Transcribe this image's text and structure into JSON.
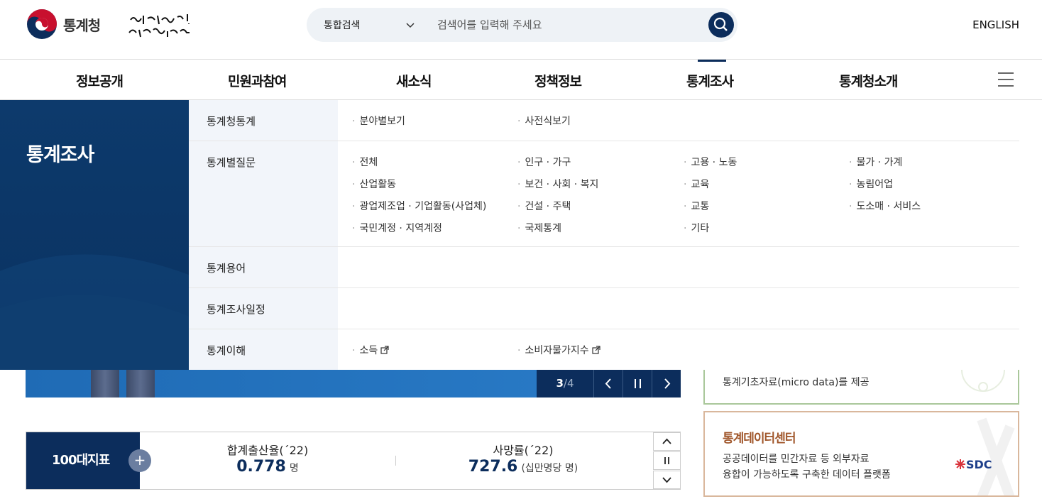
{
  "header": {
    "logo_text": "통계청",
    "search_scope": "통합검색",
    "search_placeholder": "검색어를 입력해 주세요",
    "english_label": "ENGLISH"
  },
  "gnb": {
    "items": [
      "정보공개",
      "민원과참여",
      "새소식",
      "정책정보",
      "통계조사",
      "통계청소개"
    ],
    "active": "통계조사"
  },
  "mega_menu": {
    "title": "통계조사",
    "rows": [
      {
        "label": "통계청통계",
        "items": [
          "분야별보기",
          "사전식보기"
        ]
      },
      {
        "label": "통계별질문",
        "items": [
          "전체",
          "인구 · 가구",
          "고용 · 노동",
          "물가 · 가계",
          "산업활동",
          "보건 · 사회 · 복지",
          "교육",
          "농림어업",
          "광업제조업 · 기업활동(사업체)",
          "건설 · 주택",
          "교통",
          "도소매 · 서비스",
          "국민계정 · 지역계정",
          "국제통계",
          "기타"
        ]
      },
      {
        "label": "통계용어",
        "items": []
      },
      {
        "label": "통계조사일정",
        "items": []
      },
      {
        "label": "통계이해",
        "items": [
          "소득",
          "소비자물가지수"
        ]
      }
    ]
  },
  "slider": {
    "current": "3",
    "total": "/4"
  },
  "indicators": {
    "head": "100대지표",
    "plus": "+",
    "items": [
      {
        "name": "합계출산율(´22)",
        "value": "0.778",
        "unit": "명"
      },
      {
        "name": "사망률(´22)",
        "value": "727.6",
        "unit": "(십만명당 명)"
      }
    ]
  },
  "right": {
    "box1_text": "통계기초자료(micro data)를 제공",
    "box2_title": "통계데이터센터",
    "box2_desc_1": "공공데이터를 민간자료 등 외부자료",
    "box2_desc_2": "융합이 가능하도록 구축한 데이터 플랫폼",
    "box2_logo": "SDC"
  },
  "colors": {
    "navy": "#0c2d5c",
    "blue": "#1f6bb5",
    "green_border": "#a9c79a",
    "brown": "#a0562a"
  }
}
